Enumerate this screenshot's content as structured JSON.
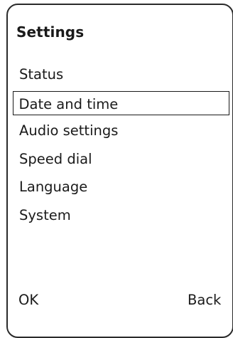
{
  "screen": {
    "title": "Settings",
    "menu": {
      "items": [
        {
          "label": "Status",
          "selected": false
        },
        {
          "label": "Date and time",
          "selected": true
        },
        {
          "label": "Audio settings",
          "selected": false
        },
        {
          "label": "Speed dial",
          "selected": false
        },
        {
          "label": "Language",
          "selected": false
        },
        {
          "label": "System",
          "selected": false
        }
      ]
    },
    "softkeys": {
      "left": "OK",
      "right": "Back"
    }
  }
}
